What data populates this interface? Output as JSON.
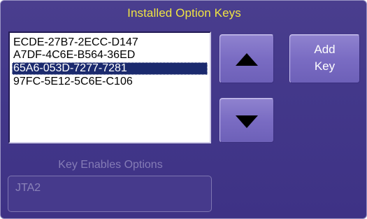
{
  "dialog": {
    "title": "Installed Option Keys"
  },
  "keys": {
    "items": [
      "ECDE-27B7-2ECC-D147",
      "A7DF-4C6E-B564-36ED",
      "65A6-053D-7277-7281",
      "97FC-5E12-5C6E-C106"
    ],
    "selected_index": 2
  },
  "buttons": {
    "scroll_up_icon": "triangle-up-icon",
    "scroll_down_icon": "triangle-down-icon",
    "add_key_line1": "Add",
    "add_key_line2": "Key"
  },
  "options": {
    "label": "Key Enables Options",
    "value": "JTA2"
  },
  "colors": {
    "background": "#43388a",
    "title_text": "#f0e442",
    "selection": "#1b2a6e",
    "button_face": "#7a6cc3",
    "disabled_text": "#857cb6"
  }
}
